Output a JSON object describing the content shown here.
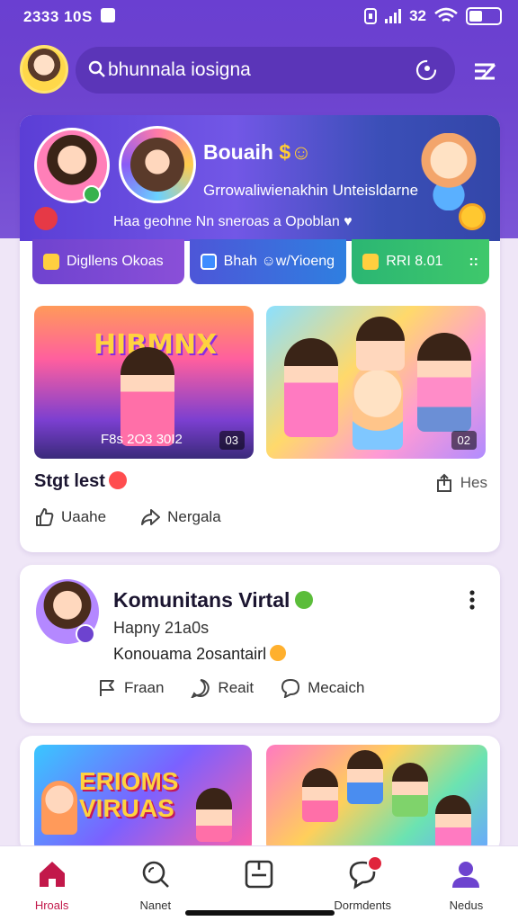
{
  "status_bar": {
    "time": "2333 10S",
    "signal_text": "32"
  },
  "header": {
    "search": {
      "value": "bhunnala iosigna"
    }
  },
  "feature_card": {
    "banner": {
      "name": "Bouaih",
      "name_emoji": "$☺",
      "subtitle": "Grrowaliwienakhin Unteisldarne",
      "tagline": "Haa geohne Nn sneroas a Opoblan ♥"
    },
    "stats": [
      {
        "label": "Digllens Okoas",
        "color": "#ffcf3f"
      },
      {
        "label": "Bhah ☺w/Yioeng",
        "color": "#3f8cff"
      },
      {
        "label": "RRI 8.01",
        "more": "::",
        "color": "#ffcf3f"
      }
    ],
    "thumbnails": [
      {
        "title": "HIBMNX",
        "caption": "F8s 2O3 30I2",
        "duration": "03"
      },
      {
        "duration": "02"
      }
    ],
    "post_label": "Stgt lest",
    "share_label": "Hes",
    "actions": [
      {
        "label": "Uaahe",
        "icon": "like-icon"
      },
      {
        "label": "Nergala",
        "icon": "share-arrow-icon"
      }
    ]
  },
  "community_card": {
    "title": "Komunitans Virtal",
    "subtitle": "Hapny 21a0s",
    "description": "Konouama 2osantairl",
    "actions": [
      {
        "label": "Fraan",
        "icon": "flag-icon"
      },
      {
        "label": "Reait",
        "icon": "comment-icon"
      },
      {
        "label": "Mecaich",
        "icon": "chat-bubble-icon"
      }
    ]
  },
  "bottom_card": {
    "thumb_title": "ERIOMS VIRUAS"
  },
  "bottom_nav": [
    {
      "label": "Hroals",
      "icon": "home-icon",
      "active": true
    },
    {
      "label": "Nanet",
      "icon": "search-icon"
    },
    {
      "label": "",
      "icon": "calendar-icon"
    },
    {
      "label": "Dormdents",
      "icon": "notification-bubble-icon"
    },
    {
      "label": "Nedus",
      "icon": "profile-icon"
    }
  ],
  "colors": {
    "accent": "#6d43cf",
    "active": "#c2184a",
    "background": "#efe6f7"
  }
}
